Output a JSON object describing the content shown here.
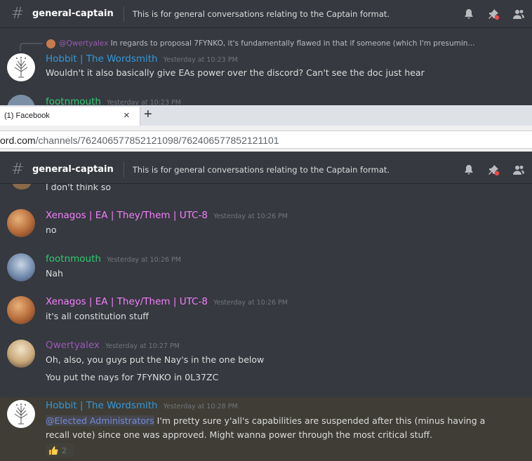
{
  "header": {
    "channel_name": "general-captain",
    "topic": "This is for general conversations relating to the Captain format."
  },
  "top_pane": {
    "reply": {
      "mention": "@Qwertyalex",
      "text": "In regards to proposal 7FYNKO, it's fundamentally flawed in that if someone (which I'm presumin..."
    },
    "messages": [
      {
        "author": "Hobbit | The Wordsmith",
        "timestamp": "Yesterday at 10:23 PM",
        "text": "Wouldn't it also basically give EAs power over the discord? Can't see the doc just hear",
        "color": "#3498db"
      },
      {
        "author": "footnmouth",
        "timestamp": "Yesterday at 10:23 PM",
        "color": "#2ecc71"
      }
    ]
  },
  "browser": {
    "tab_title": "(1) Facebook",
    "close": "×",
    "new_tab": "+",
    "url_host": "ord.com",
    "url_path": "/channels/762406577852121098/762406577852121101"
  },
  "bottom_pane": {
    "partial_text": "I don't think so",
    "messages": [
      {
        "author": "Xenagos | EA | They/Them | UTC-8",
        "timestamp": "Yesterday at 10:26 PM",
        "lines": [
          "no"
        ],
        "color": "#f47fff"
      },
      {
        "author": "footnmouth",
        "timestamp": "Yesterday at 10:26 PM",
        "lines": [
          "Nah"
        ],
        "color": "#2ecc71"
      },
      {
        "author": "Xenagos | EA | They/Them | UTC-8",
        "timestamp": "Yesterday at 10:26 PM",
        "lines": [
          "it's all constitution stuff"
        ],
        "color": "#f47fff"
      },
      {
        "author": "Qwertyalex",
        "timestamp": "Yesterday at 10:27 PM",
        "lines": [
          "Oh, also, you guys put the Nay's in the one below",
          "You put the nays for 7FYNKO in 0L37ZC"
        ],
        "color": "#9b59b6"
      },
      {
        "author": "Hobbit | The Wordsmith",
        "timestamp": "Yesterday at 10:28 PM",
        "mention": "@Elected Administrators",
        "lines": [
          "I'm pretty sure y'all's capabilities are suspended after this (minus having a",
          "recall vote) since one was approved. Might wanna power through the most critical stuff."
        ],
        "color": "#3498db"
      }
    ],
    "reaction": {
      "emoji": "thumbs-up-icon",
      "count": "2"
    }
  }
}
